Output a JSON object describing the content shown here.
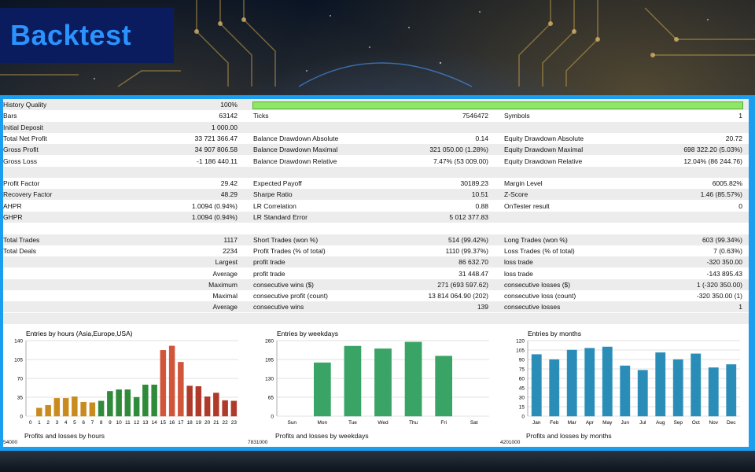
{
  "header": {
    "title": "Backtest"
  },
  "rows": [
    {
      "shade": true,
      "cells": [
        {
          "label": "History Quality",
          "value": "100%"
        }
      ],
      "bar": true
    },
    {
      "shade": false,
      "cells": [
        {
          "label": "Bars",
          "value": "63142"
        },
        {
          "label": "Ticks",
          "value": "7546472"
        },
        {
          "label": "Symbols",
          "value": "1"
        }
      ]
    },
    {
      "shade": true,
      "cells": [
        {
          "label": "Initial Deposit",
          "value": "1 000.00"
        }
      ]
    },
    {
      "shade": false,
      "cells": [
        {
          "label": "Total Net Profit",
          "value": "33 721 366.47"
        },
        {
          "label": "Balance Drawdown Absolute",
          "value": "0.14"
        },
        {
          "label": "Equity Drawdown Absolute",
          "value": "20.72"
        }
      ]
    },
    {
      "shade": true,
      "cells": [
        {
          "label": "Gross Profit",
          "value": "34 907 806.58"
        },
        {
          "label": "Balance Drawdown Maximal",
          "value": "321 050.00 (1.28%)"
        },
        {
          "label": "Equity Drawdown Maximal",
          "value": "698 322.20 (5.03%)"
        }
      ]
    },
    {
      "shade": false,
      "cells": [
        {
          "label": "Gross Loss",
          "value": "-1 186 440.11"
        },
        {
          "label": "Balance Drawdown Relative",
          "value": "7.47% (53 009.00)"
        },
        {
          "label": "Equity Drawdown Relative",
          "value": "12.04% (86 244.76)"
        }
      ]
    },
    {
      "shade": true,
      "cells": []
    },
    {
      "shade": false,
      "cells": [
        {
          "label": "Profit Factor",
          "value": "29.42"
        },
        {
          "label": "Expected Payoff",
          "value": "30189.23"
        },
        {
          "label": "Margin Level",
          "value": "6005.82%"
        }
      ]
    },
    {
      "shade": true,
      "cells": [
        {
          "label": "Recovery Factor",
          "value": "48.29"
        },
        {
          "label": "Sharpe Ratio",
          "value": "10.51"
        },
        {
          "label": "Z-Score",
          "value": "1.46 (85.57%)"
        }
      ]
    },
    {
      "shade": false,
      "cells": [
        {
          "label": "AHPR",
          "value": "1.0094 (0.94%)"
        },
        {
          "label": "LR Correlation",
          "value": "0.88"
        },
        {
          "label": "OnTester result",
          "value": "0"
        }
      ]
    },
    {
      "shade": true,
      "cells": [
        {
          "label": "GHPR",
          "value": "1.0094 (0.94%)"
        },
        {
          "label": "LR Standard Error",
          "value": "5 012 377.83"
        }
      ]
    },
    {
      "shade": false,
      "cells": []
    },
    {
      "shade": true,
      "cells": [
        {
          "label": "Total Trades",
          "value": "1117"
        },
        {
          "label": "Short Trades (won %)",
          "value": "514 (99.42%)"
        },
        {
          "label": "Long Trades (won %)",
          "value": "603 (99.34%)"
        }
      ]
    },
    {
      "shade": false,
      "cells": [
        {
          "label": "Total Deals",
          "value": "2234"
        },
        {
          "label": "Profit Trades (% of total)",
          "value": "1110 (99.37%)"
        },
        {
          "label": "Loss Trades (% of total)",
          "value": "7 (0.63%)"
        }
      ]
    },
    {
      "shade": true,
      "cells": [
        {
          "label": "",
          "value": "Largest"
        },
        {
          "label": "profit trade",
          "value": "86 632.70"
        },
        {
          "label": "loss trade",
          "value": "-320 350.00"
        }
      ]
    },
    {
      "shade": false,
      "cells": [
        {
          "label": "",
          "value": "Average"
        },
        {
          "label": "profit trade",
          "value": "31 448.47"
        },
        {
          "label": "loss trade",
          "value": "-143 895.43"
        }
      ]
    },
    {
      "shade": true,
      "cells": [
        {
          "label": "",
          "value": "Maximum"
        },
        {
          "label": "consecutive wins ($)",
          "value": "271 (693 597.62)"
        },
        {
          "label": "consecutive losses ($)",
          "value": "1 (-320 350.00)"
        }
      ]
    },
    {
      "shade": false,
      "cells": [
        {
          "label": "",
          "value": "Maximal"
        },
        {
          "label": "consecutive profit (count)",
          "value": "13 814 064.90 (202)"
        },
        {
          "label": "consecutive loss (count)",
          "value": "-320 350.00 (1)"
        }
      ]
    },
    {
      "shade": true,
      "cells": [
        {
          "label": "",
          "value": "Average"
        },
        {
          "label": "consecutive wins",
          "value": "139"
        },
        {
          "label": "consecutive losses",
          "value": "1"
        }
      ]
    }
  ],
  "chart_data": [
    {
      "type": "bar",
      "title": "Entries by hours (Asia,Europe,USA)",
      "categories": [
        "0",
        "1",
        "2",
        "3",
        "4",
        "5",
        "6",
        "7",
        "8",
        "9",
        "10",
        "11",
        "12",
        "13",
        "14",
        "15",
        "16",
        "17",
        "18",
        "19",
        "20",
        "21",
        "22",
        "23"
      ],
      "values": [
        0,
        15,
        20,
        33,
        33,
        36,
        26,
        25,
        28,
        46,
        49,
        49,
        35,
        58,
        58,
        122,
        130,
        100,
        56,
        55,
        36,
        43,
        29,
        28
      ],
      "yticks": [
        0,
        35,
        70,
        105,
        140
      ],
      "ylim": [
        0,
        140
      ],
      "colors": [
        "#c98a1e",
        "#c98a1e",
        "#c98a1e",
        "#c98a1e",
        "#c98a1e",
        "#c98a1e",
        "#c98a1e",
        "#c98a1e",
        "#2f8a3a",
        "#2f8a3a",
        "#2f8a3a",
        "#2f8a3a",
        "#2f8a3a",
        "#2f8a3a",
        "#2f8a3a",
        "#d0553a",
        "#d0553a",
        "#d0553a",
        "#b03a2a",
        "#b03a2a",
        "#b03a2a",
        "#b03a2a",
        "#b03a2a",
        "#b03a2a"
      ]
    },
    {
      "type": "bar",
      "title": "Entries by weekdays",
      "categories": [
        "Sun",
        "Mon",
        "Tue",
        "Wed",
        "Thu",
        "Fri",
        "Sat"
      ],
      "values": [
        0,
        184,
        241,
        232,
        255,
        207,
        0
      ],
      "yticks": [
        0,
        65,
        130,
        195,
        260
      ],
      "ylim": [
        0,
        260
      ],
      "color": "#3aa466"
    },
    {
      "type": "bar",
      "title": "Entries by months",
      "categories": [
        "Jan",
        "Feb",
        "Mar",
        "Apr",
        "May",
        "Jun",
        "Jul",
        "Aug",
        "Sep",
        "Oct",
        "Nov",
        "Dec"
      ],
      "values": [
        98,
        90,
        105,
        108,
        110,
        80,
        73,
        101,
        90,
        99,
        77,
        82
      ],
      "yticks": [
        0,
        15,
        30,
        45,
        60,
        75,
        90,
        105,
        120
      ],
      "ylim": [
        0,
        120
      ],
      "color": "#2a8db8"
    }
  ],
  "pl_titles": [
    {
      "title": "Profits and losses by hours",
      "axis": "54000"
    },
    {
      "title": "Profits and losses by weekdays",
      "axis": "7831000"
    },
    {
      "title": "Profits and losses by months",
      "axis": "4201000"
    }
  ]
}
